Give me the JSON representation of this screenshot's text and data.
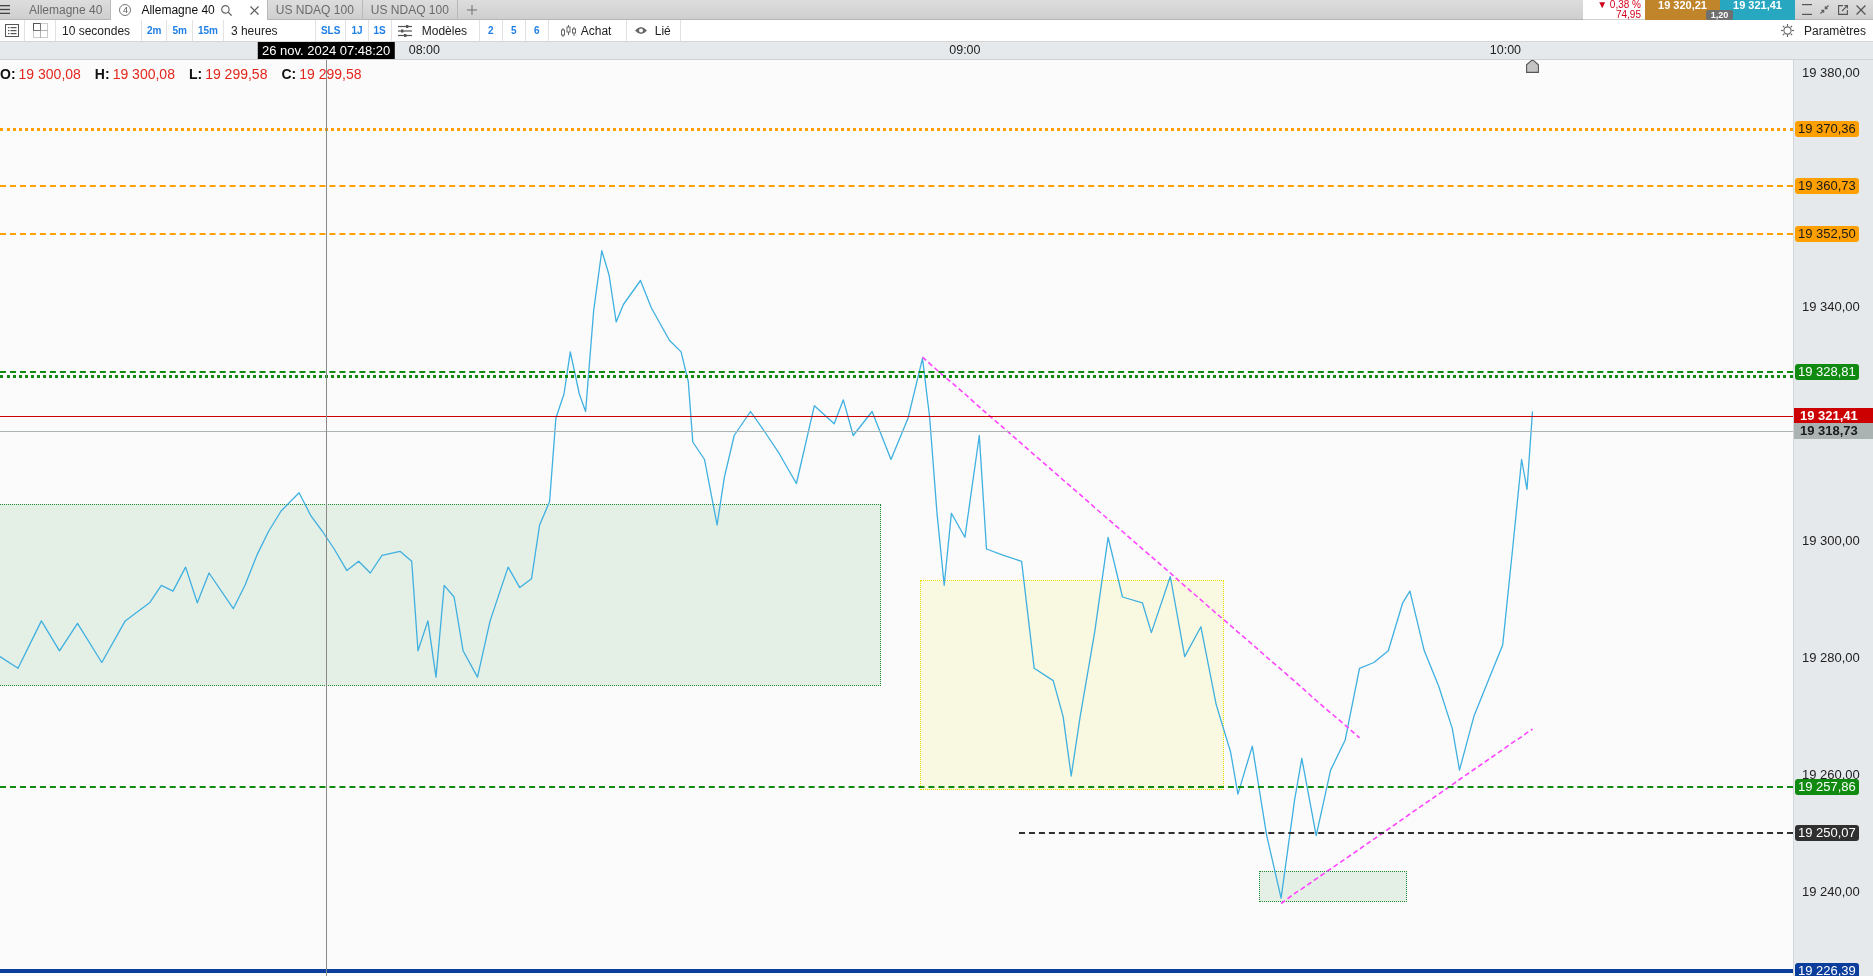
{
  "tabs": [
    {
      "label": "Allemagne 40",
      "selected": false
    },
    {
      "label": "Allemagne 40",
      "selected": true,
      "badge": "4"
    },
    {
      "label": "US NDAQ 100",
      "selected": false
    },
    {
      "label": "US NDAQ 100",
      "selected": false
    }
  ],
  "quote": {
    "change_percent": "▼ 0,38 %",
    "change": "74,95",
    "bid": "19 320,21",
    "ask": "19 321,41",
    "spread": "1,20"
  },
  "toolbar": {
    "interval": "10 secondes",
    "interval_shortcuts": [
      "2m",
      "5m",
      "15m"
    ],
    "period": "3 heures",
    "period_shortcuts": [
      "SLS",
      "1J",
      "1S"
    ],
    "templates": "Modèles",
    "template_slots": [
      "2",
      "5",
      "6"
    ],
    "order": "Achat",
    "link": "Lié",
    "settings": "Paramètres"
  },
  "chart": {
    "ohlc": [
      {
        "label": "O:",
        "value": "19 300,08"
      },
      {
        "label": "H:",
        "value": "19 300,08"
      },
      {
        "label": "L:",
        "value": "19 299,58"
      },
      {
        "label": "C:",
        "value": "19 299,58"
      }
    ],
    "cursor": {
      "label": "26 nov. 2024 07:48:20"
    },
    "zones": [
      {
        "color": "#1e8c2e"
      },
      {
        "color": "#f0e000"
      },
      {
        "color": "#1e8c2e"
      }
    ],
    "chart_data": {
      "type": "line",
      "x": [
        432.9,
        434.9,
        437.5,
        439.5,
        441.5,
        444.2,
        446.8,
        449.5,
        450.8,
        452.1,
        453.5,
        454.8,
        456.1,
        458.8,
        460.1,
        461.4,
        462.7,
        464.1,
        466.1,
        467.4,
        468.7,
        470.0,
        471.4,
        472.7,
        474.0,
        475.3,
        477.3,
        478.6,
        479.3,
        480.4,
        481.3,
        482.2,
        483.3,
        484.3,
        485.9,
        487.3,
        489.3,
        490.6,
        491.9,
        492.8,
        493.9,
        494.6,
        495.5,
        496.2,
        497.2,
        497.9,
        498.8,
        499.7,
        500.5,
        501.3,
        502.1,
        504.0,
        505.2,
        507.2,
        508.5,
        509.3,
        509.8,
        511.1,
        512.5,
        513.3,
        514.4,
        516.2,
        517.8,
        519.4,
        521.3,
        523.3,
        525.5,
        526.5,
        527.6,
        529.7,
        531.8,
        533.7,
        535.3,
        536.1,
        536.9,
        537.7,
        538.5,
        540.0,
        541.6,
        542.4,
        544.3,
        546.3,
        547.7,
        549.8,
        550.9,
        551.8,
        552.8,
        554.4,
        555.9,
        557.5,
        559.7,
        560.7,
        562.8,
        564.4,
        566.2,
        567.9,
        569.5,
        570.3,
        571.9,
        573.5,
        575.1,
        576.6,
        577.4,
        579.0,
        580.6,
        582.2,
        583.8,
        585.4,
        587.0,
        588.6,
        589.4,
        591.0,
        592.6,
        594.1,
        594.9,
        596.5,
        598.1,
        599.7,
        600.8,
        601.8,
        602.4,
        603.0
      ],
      "series": [
        {
          "color": "#3fb0e0",
          "values": [
            19280.2,
            19278.2,
            19286.3,
            19281.2,
            19285.9,
            19279.2,
            19286.3,
            19289.4,
            19292.4,
            19291.4,
            19295.5,
            19289.4,
            19294.5,
            19288.4,
            19292.4,
            19297.5,
            19301.6,
            19305.1,
            19308.2,
            19304.3,
            19301.6,
            19298.6,
            19294.9,
            19296.5,
            19294.5,
            19297.5,
            19298.2,
            19296.5,
            19281.2,
            19286.3,
            19276.7,
            19292.4,
            19290.4,
            19281.2,
            19276.7,
            19286.3,
            19295.5,
            19292.0,
            19293.5,
            19302.7,
            19306.7,
            19321.0,
            19325.1,
            19332.3,
            19325.1,
            19322.1,
            19339.4,
            19349.6,
            19345.5,
            19337.4,
            19340.4,
            19344.5,
            19339.8,
            19334.3,
            19332.3,
            19327.2,
            19316.9,
            19313.9,
            19302.7,
            19310.8,
            19318.0,
            19322.1,
            19318.6,
            19314.9,
            19309.8,
            19323.1,
            19320.0,
            19324.1,
            19318.0,
            19322.1,
            19313.9,
            19321.0,
            19331.2,
            19321.0,
            19304.7,
            19292.4,
            19304.7,
            19300.6,
            19318.0,
            19298.6,
            19297.5,
            19296.5,
            19278.2,
            19276.1,
            19270.0,
            19259.8,
            19270.0,
            19284.3,
            19300.6,
            19290.4,
            19289.4,
            19284.3,
            19293.9,
            19280.2,
            19285.3,
            19272.0,
            19263.9,
            19256.7,
            19264.9,
            19249.6,
            19238.9,
            19255.7,
            19262.8,
            19249.6,
            19260.8,
            19265.9,
            19278.2,
            19279.2,
            19281.2,
            19289.4,
            19291.4,
            19281.2,
            19275.1,
            19267.9,
            19260.8,
            19270.0,
            19276.1,
            19282.2,
            19298.6,
            19313.9,
            19308.8,
            19322.1
          ]
        },
        {
          "color": "#ff44ff",
          "line_style": "dashed",
          "values": [
            null,
            null,
            null,
            null,
            null,
            null,
            null,
            null,
            null,
            null,
            null,
            null,
            null,
            null,
            null,
            null,
            null,
            null,
            null,
            null,
            null,
            null,
            null,
            null,
            null,
            null,
            null,
            null,
            null,
            null,
            null,
            null,
            null,
            null,
            null,
            null,
            null,
            null,
            null,
            null,
            null,
            null,
            null,
            null,
            null,
            null,
            null,
            null,
            null,
            null,
            null,
            null,
            null,
            null,
            null,
            null,
            null,
            null,
            null,
            null,
            null,
            null,
            null,
            null,
            null,
            null,
            null,
            null,
            null,
            null,
            null,
            null,
            19331.4,
            19330.3,
            19329.2,
            19328.1,
            19327.1,
            19325.1,
            19322.9,
            19321.8,
            19319.3,
            19316.6,
            19314.7,
            19311.9,
            19310.4,
            19309.2,
            19307.9,
            19305.7,
            19303.7,
            19301.6,
            19298.6,
            19297.3,
            19294.5,
            19292.3,
            19289.9,
            19287.6,
            19285.5,
            19284.4,
            19282.3,
            19280.1,
            19278.0,
            19276.0,
            19274.9,
            19272.7,
            19270.6,
            19268.5,
            19266.3,
            null,
            null,
            null,
            null,
            null,
            null,
            null,
            null,
            null,
            null,
            null,
            null,
            null,
            null,
            null
          ]
        },
        {
          "color": "#ff44ff",
          "line_style": "dashed",
          "values": [
            null,
            null,
            null,
            null,
            null,
            null,
            null,
            null,
            null,
            null,
            null,
            null,
            null,
            null,
            null,
            null,
            null,
            null,
            null,
            null,
            null,
            null,
            null,
            null,
            null,
            null,
            null,
            null,
            null,
            null,
            null,
            null,
            null,
            null,
            null,
            null,
            null,
            null,
            null,
            null,
            null,
            null,
            null,
            null,
            null,
            null,
            null,
            null,
            null,
            null,
            null,
            null,
            null,
            null,
            null,
            null,
            null,
            null,
            null,
            null,
            null,
            null,
            null,
            null,
            null,
            null,
            null,
            null,
            null,
            null,
            null,
            null,
            null,
            null,
            null,
            null,
            null,
            null,
            null,
            null,
            null,
            null,
            null,
            null,
            null,
            null,
            null,
            null,
            null,
            null,
            null,
            null,
            null,
            null,
            null,
            null,
            null,
            null,
            null,
            null,
            19238.0,
            19239.7,
            19240.5,
            19242.2,
            19243.9,
            19245.6,
            19247.3,
            19249.0,
            19250.7,
            19252.4,
            19253.3,
            19255.0,
            19256.7,
            19258.3,
            19259.2,
            19260.9,
            19262.6,
            19264.3,
            19265.5,
            19266.5,
            19267.2,
            19267.8
          ]
        }
      ],
      "xlim": [
        432.9,
        640.8
      ],
      "ylim": [
        19225.6,
        19382.2
      ],
      "xticks": [
        {
          "value": 480,
          "label": "08:00"
        },
        {
          "value": 540,
          "label": "09:00"
        },
        {
          "value": 600,
          "label": "10:00"
        }
      ],
      "yticks": [
        {
          "value": 19380,
          "label": "19 380,00"
        },
        {
          "value": 19340,
          "label": "19 340,00"
        },
        {
          "value": 19300,
          "label": "19 300,00"
        },
        {
          "value": 19280,
          "label": "19 280,00"
        },
        {
          "value": 19260,
          "label": "19 260,00"
        },
        {
          "value": 19240,
          "label": "19 240,00"
        }
      ],
      "ref_lines": [
        {
          "axis": "x",
          "value": 469.1,
          "color": "#8a8a8a"
        },
        {
          "axis": "y",
          "value": 19370.36,
          "label": "19 370,36",
          "color": "#ffa000"
        },
        {
          "axis": "y",
          "value": 19360.73,
          "label": "19 360,73",
          "color": "#ffa000"
        },
        {
          "axis": "y",
          "value": 19352.5,
          "label": "19 352,50",
          "color": "#ffa000"
        },
        {
          "axis": "y",
          "value": 19328.81,
          "label": "19 328,81",
          "color": "#108a10"
        },
        {
          "axis": "y",
          "value": 19328.1,
          "color": "#108a10"
        },
        {
          "axis": "y",
          "value": 19321.41,
          "label": "19 321,41",
          "color": "#cc0000"
        },
        {
          "axis": "y",
          "value": 19318.73,
          "label": "19 318,73",
          "color": "#aab2b2"
        },
        {
          "axis": "y",
          "value": 19257.86,
          "label": "19 257,86",
          "color": "#108a10"
        },
        {
          "axis": "y",
          "value": 19250.07,
          "label": "19 250,07",
          "color": "#303030"
        },
        {
          "axis": "y",
          "value": 19226.39,
          "label": "19 226,39",
          "color": "#0a3d9c"
        }
      ]
    }
  }
}
